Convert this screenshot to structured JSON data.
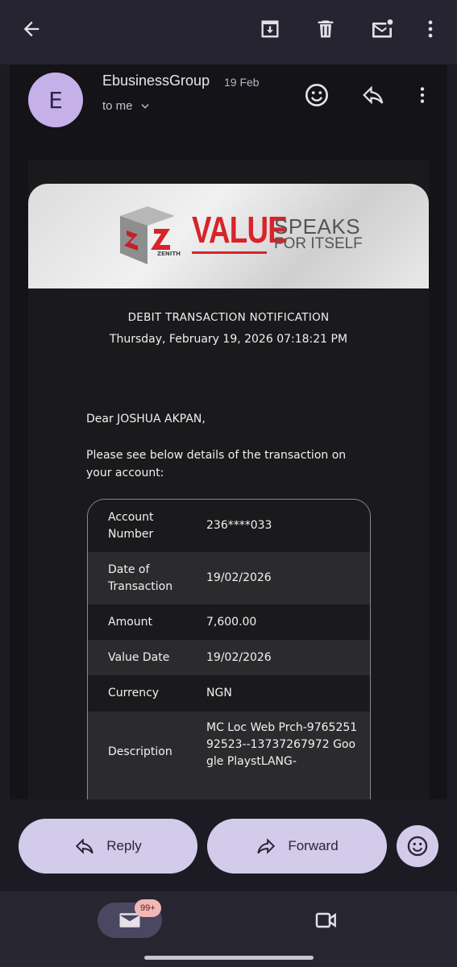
{
  "toolbar": {
    "back_icon": "arrow-left-icon",
    "archive_icon": "archive-icon",
    "delete_icon": "trash-icon",
    "unread_icon": "mark-unread-icon",
    "more_icon": "more-vert-icon"
  },
  "email": {
    "avatar_letter": "E",
    "sender": "EbusinessGroup",
    "date": "19 Feb",
    "recipient": "to me"
  },
  "banner": {
    "value_word": "VALUE",
    "speaks": "SPEAKS",
    "for_itself": "FOR ITSELF",
    "logo_letter": "Z",
    "logo_text": "ZENITH"
  },
  "message": {
    "title": "DEBIT TRANSACTION NOTIFICATION",
    "timestamp": "Thursday, February 19, 2026 07:18:21 PM",
    "greeting": "Dear JOSHUA AKPAN,",
    "intro": "Please see below details of the transaction on your account:"
  },
  "transaction": {
    "rows": [
      {
        "label": "Account Number",
        "value": "236****033"
      },
      {
        "label": "Date of Transaction",
        "value": "19/02/2026"
      },
      {
        "label": "Amount",
        "value": "7,600.00"
      },
      {
        "label": "Value Date",
        "value": "19/02/2026"
      },
      {
        "label": "Currency",
        "value": "NGN"
      },
      {
        "label": "Description",
        "value": "MC Loc Web Prch-976525192523--13737267972 Google PlaystLANG-"
      }
    ]
  },
  "actions": {
    "reply": "Reply",
    "forward": "Forward"
  },
  "nav": {
    "mail_badge": "99+"
  },
  "colors": {
    "accent": "#d3cbea",
    "zenith_red": "#d8232a",
    "background": "#1c1b23"
  }
}
